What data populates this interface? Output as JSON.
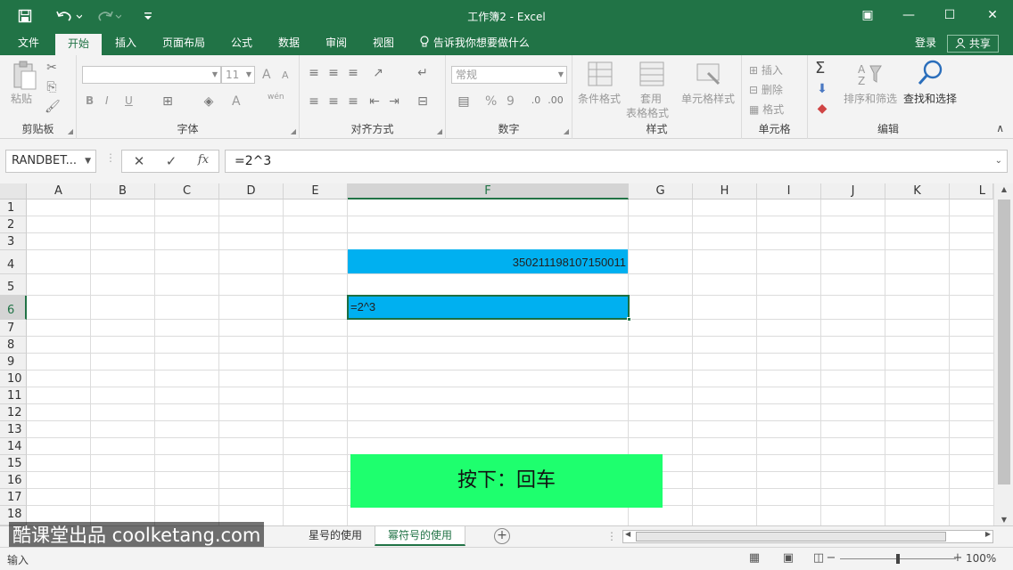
{
  "app": {
    "title": "工作簿2 - Excel",
    "qa_icons": [
      "save-icon",
      "undo-icon",
      "redo-icon",
      "customize-icon"
    ],
    "window_controls": {
      "restore_ribbon": "▣",
      "minimize": "—",
      "maximize": "☐",
      "close": "✕"
    }
  },
  "tabs": {
    "items": [
      "文件",
      "开始",
      "插入",
      "页面布局",
      "公式",
      "数据",
      "审阅",
      "视图"
    ],
    "active_index": 1,
    "tell_me": "告诉我你想要做什么",
    "login": "登录",
    "share": "共享"
  },
  "ribbon": {
    "clipboard": {
      "label": "剪贴板",
      "paste": "粘贴"
    },
    "font": {
      "label": "字体",
      "font_size": "11",
      "bold": "B",
      "italic": "I",
      "underline": "U",
      "grow": "A",
      "shrink": "A",
      "font_color": "A",
      "phonetic": "wén"
    },
    "alignment": {
      "label": "对齐方式"
    },
    "number": {
      "label": "数字",
      "format": "常规",
      "percent": "%",
      "comma": "9"
    },
    "styles": {
      "label": "样式",
      "conditional": "条件格式",
      "table_fmt_1": "套用",
      "table_fmt_2": "表格格式",
      "cell_styles": "单元格样式"
    },
    "cells": {
      "label": "单元格",
      "insert": "插入",
      "delete": "删除",
      "format": "格式"
    },
    "editing": {
      "label": "编辑",
      "sum": "Σ",
      "sort_filter": "排序和筛选",
      "find_select": "查找和选择"
    },
    "collapse": "∧"
  },
  "formula_bar": {
    "name_box": "RANDBET...",
    "cancel": "✕",
    "enter": "✓",
    "fx": "fx",
    "value": "=2^3"
  },
  "grid": {
    "columns": [
      "A",
      "B",
      "C",
      "D",
      "E",
      "F",
      "G",
      "H",
      "I",
      "J",
      "K",
      "L"
    ],
    "selected_column": "F",
    "rows": [
      "1",
      "2",
      "3",
      "4",
      "5",
      "6",
      "7",
      "8",
      "9",
      "10",
      "11",
      "12",
      "13",
      "14",
      "15",
      "16",
      "17",
      "18"
    ],
    "selected_row": "6",
    "cells": {
      "F4": "350211198107150011",
      "F6": "=2^3"
    },
    "highlight_color": "#00b0f0",
    "hint": "按下：回车",
    "hint_color": "#1eff6e"
  },
  "sheet_tabs": {
    "items": [
      "星号的使用",
      "幂符号的使用"
    ],
    "active_index": 1,
    "add": "+"
  },
  "watermark": "酷课堂出品 coolketang.com",
  "status": {
    "mode": "输入",
    "zoom": "100%"
  },
  "colors": {
    "brand": "#217346"
  }
}
